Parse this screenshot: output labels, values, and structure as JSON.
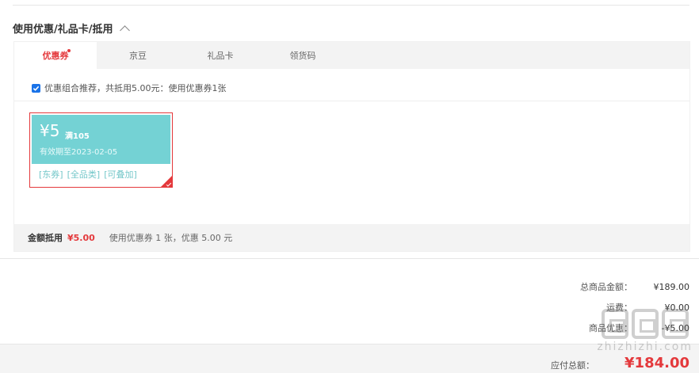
{
  "section": {
    "title": "使用优惠/礼品卡/抵用",
    "chevron_icon": "chevron-up-icon"
  },
  "tabs": [
    {
      "label": "优惠券",
      "active": true,
      "badge": "red-dot"
    },
    {
      "label": "京豆",
      "active": false
    },
    {
      "label": "礼品卡",
      "active": false
    },
    {
      "label": "领货码",
      "active": false
    }
  ],
  "recommend": {
    "checked": true,
    "text": "优惠组合推荐，共抵用5.00元：使用优惠券1张"
  },
  "coupon": {
    "amount": "¥5",
    "threshold": "满105",
    "validity": "有效期至2023-02-05",
    "tags": [
      "[东券]",
      "[全品类]",
      "[可叠加]"
    ],
    "selected": true,
    "color": "#74d2d4"
  },
  "summary": {
    "label": "金额抵用",
    "amount": "¥5.00",
    "desc": "使用优惠券 1 张，优惠 5.00 元"
  },
  "totals": [
    {
      "label": "总商品金额：",
      "value": "¥189.00"
    },
    {
      "label": "运费：",
      "value": "¥0.00"
    },
    {
      "label": "商品优惠：",
      "value": "-¥5.00"
    }
  ],
  "payable": {
    "label": "应付总额：",
    "value": "¥184.00"
  },
  "watermark": {
    "text": "zhizhizhi.com"
  },
  "colors": {
    "accent": "#e4393c",
    "coupon": "#74d2d4",
    "bar": "#f3f3f3"
  }
}
